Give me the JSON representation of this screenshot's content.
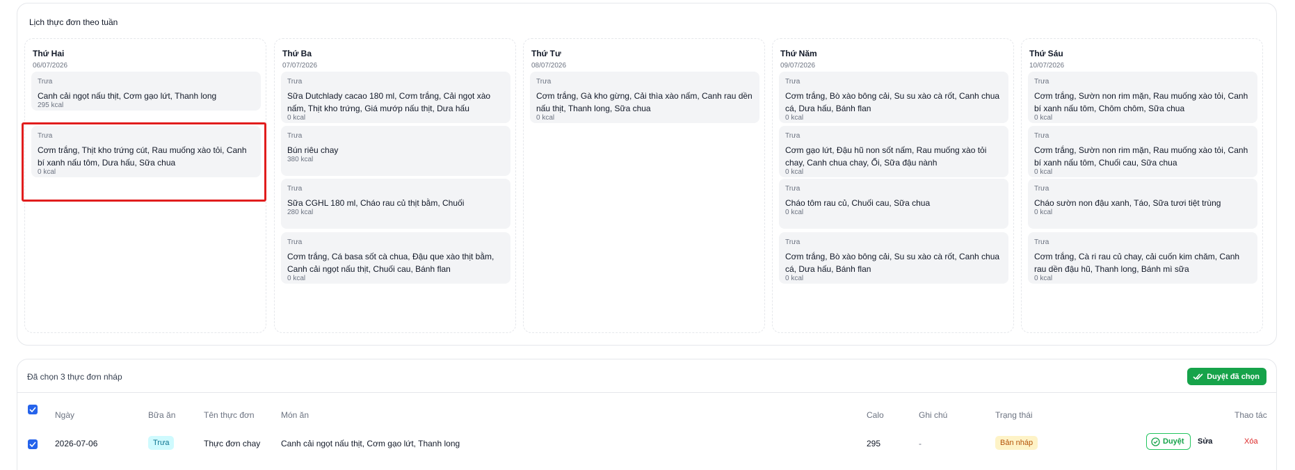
{
  "schedule": {
    "title": "Lịch thực đơn theo tuần",
    "days": [
      {
        "name": "Thứ Hai",
        "date": "06/07/2026",
        "meals": [
          {
            "type": "Trưa",
            "dishes": "Canh cải ngọt nấu thịt, Cơm gạo lứt, Thanh long",
            "kcal": "295 kcal"
          },
          {
            "type": "Trưa",
            "dishes": "Cơm trắng, Thịt kho trứng cút, Rau muống xào tỏi, Canh bí xanh nấu tôm, Dưa hấu, Sữa chua",
            "kcal": "0 kcal"
          }
        ]
      },
      {
        "name": "Thứ Ba",
        "date": "07/07/2026",
        "meals": [
          {
            "type": "Trưa",
            "dishes": "Sữa Dutchlady cacao 180 ml, Cơm trắng, Cải ngọt xào nấm, Thịt kho trứng, Giá mướp nấu thịt, Dưa hấu",
            "kcal": "0 kcal"
          },
          {
            "type": "Trưa",
            "dishes": "Bún riêu chay",
            "kcal": "380 kcal"
          },
          {
            "type": "Trưa",
            "dishes": "Sữa CGHL 180 ml, Cháo rau củ thịt bằm, Chuối",
            "kcal": "280 kcal"
          },
          {
            "type": "Trưa",
            "dishes": "Cơm trắng, Cá basa sốt cà chua, Đậu que xào thịt bằm, Canh cải ngọt nấu thịt, Chuối cau, Bánh flan",
            "kcal": "0 kcal"
          }
        ]
      },
      {
        "name": "Thứ Tư",
        "date": "08/07/2026",
        "meals": [
          {
            "type": "Trưa",
            "dishes": "Cơm trắng, Gà kho gừng, Cải thìa xào nấm, Canh rau dền nấu thịt, Thanh long, Sữa chua",
            "kcal": "0 kcal"
          }
        ]
      },
      {
        "name": "Thứ Năm",
        "date": "09/07/2026",
        "meals": [
          {
            "type": "Trưa",
            "dishes": "Cơm trắng, Bò xào bông cải, Su su xào cà rốt, Canh chua cá, Dưa hấu, Bánh flan",
            "kcal": "0 kcal"
          },
          {
            "type": "Trưa",
            "dishes": "Cơm gạo lứt, Đậu hũ non sốt nấm, Rau muống xào tỏi chay, Canh chua chay, Ổi, Sữa đậu nành",
            "kcal": "0 kcal"
          },
          {
            "type": "Trưa",
            "dishes": "Cháo tôm rau củ, Chuối cau, Sữa chua",
            "kcal": "0 kcal"
          },
          {
            "type": "Trưa",
            "dishes": "Cơm trắng, Bò xào bông cải, Su su xào cà rốt, Canh chua cá, Dưa hấu, Bánh flan",
            "kcal": "0 kcal"
          }
        ]
      },
      {
        "name": "Thứ Sáu",
        "date": "10/07/2026",
        "meals": [
          {
            "type": "Trưa",
            "dishes": "Cơm trắng, Sườn non rim mặn, Rau muống xào tỏi, Canh bí xanh nấu tôm, Chôm chôm, Sữa chua",
            "kcal": "0 kcal"
          },
          {
            "type": "Trưa",
            "dishes": "Cơm trắng, Sườn non rim mặn, Rau muống xào tỏi, Canh bí xanh nấu tôm, Chuối cau, Sữa chua",
            "kcal": "0 kcal"
          },
          {
            "type": "Trưa",
            "dishes": "Cháo sườn non đậu xanh, Táo, Sữa tươi tiệt trùng",
            "kcal": "0 kcal"
          },
          {
            "type": "Trưa",
            "dishes": "Cơm trắng, Cà ri rau củ chay, cải cuốn kim chăm, Canh rau dền đậu hũ, Thanh long, Bánh mì sữa",
            "kcal": "0 kcal"
          }
        ]
      }
    ]
  },
  "drafts": {
    "title": "Đã chọn 3 thực đơn nháp",
    "approve_selected_label": "Duyệt đã chọn",
    "columns": {
      "date": "Ngày",
      "meal": "Bữa ăn",
      "menu_name": "Tên thực đơn",
      "dishes": "Món ăn",
      "calories": "Calo",
      "note": "Ghi chú",
      "status": "Trạng thái",
      "actions": "Thao tác"
    },
    "rows": [
      {
        "date": "2026-07-06",
        "meal": "Trưa",
        "menu_name": "Thực đơn chay",
        "dishes": "Canh cải ngọt nấu thịt, Cơm gạo lứt, Thanh long",
        "calories": "295",
        "note": "-",
        "status": "Bản nháp",
        "approve_label": "Duyệt",
        "edit_label": "Sửa",
        "delete_label": "Xóa"
      }
    ]
  },
  "colors": {
    "accent_green": "#16a34a",
    "checkbox_blue": "#2563eb",
    "danger_red": "#dc2626",
    "highlight_red": "#e11d1d"
  },
  "icons": [
    "double-check-icon",
    "check-circle-icon",
    "checkbox-checked-icon"
  ]
}
